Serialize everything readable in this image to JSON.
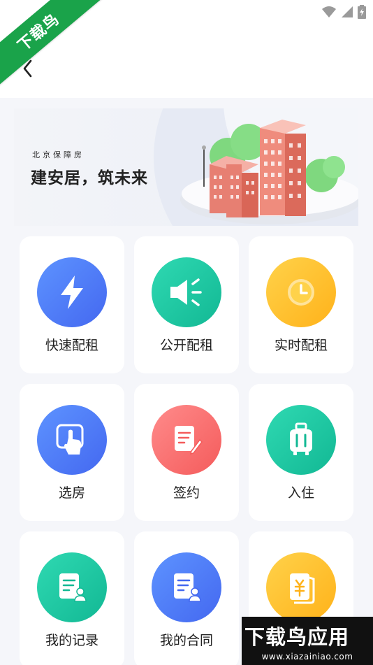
{
  "watermark": {
    "ribbon_text": "下载鸟",
    "title": "下载鸟应用",
    "url": "www.xiazainiao.com"
  },
  "banner": {
    "subtitle": "北京保障房",
    "title": "建安居，筑未来"
  },
  "menu": [
    {
      "label": "快速配租",
      "icon": "lightning-icon",
      "color": "#4f7cf7"
    },
    {
      "label": "公开配租",
      "icon": "speaker-icon",
      "color": "#1ec8a5"
    },
    {
      "label": "实时配租",
      "icon": "clock-icon",
      "color": "#ffc233"
    },
    {
      "label": "选房",
      "icon": "touch-select-icon",
      "color": "#4f7cf7"
    },
    {
      "label": "签约",
      "icon": "sign-document-icon",
      "color": "#fb6e6e"
    },
    {
      "label": "入住",
      "icon": "luggage-icon",
      "color": "#1ec8a5"
    },
    {
      "label": "我的记录",
      "icon": "record-icon",
      "color": "#1ec8a5"
    },
    {
      "label": "我的合同",
      "icon": "contract-icon",
      "color": "#4f7cf7"
    },
    {
      "label": "",
      "icon": "payment-icon",
      "color": "#ffc233"
    }
  ]
}
